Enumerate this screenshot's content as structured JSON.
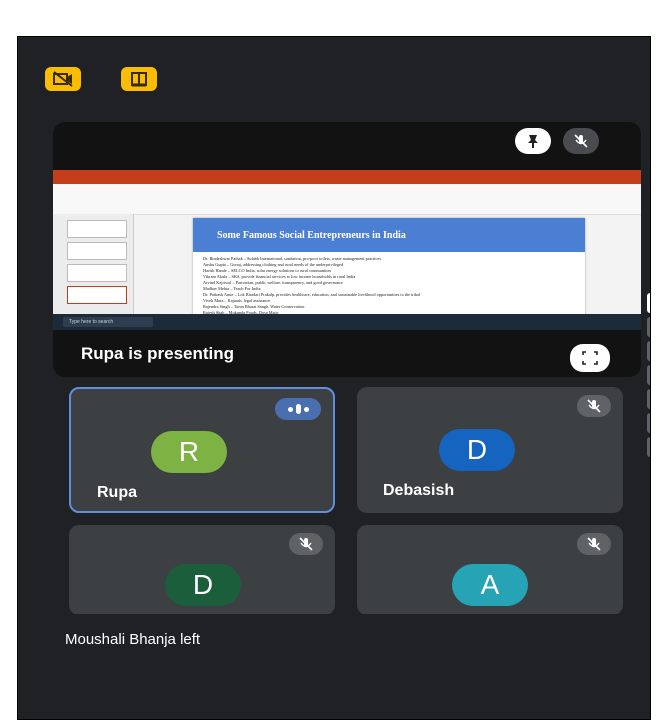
{
  "top_controls": {
    "camera_off_icon": "video-off-icon",
    "flip_icon": "layout-icon"
  },
  "stage": {
    "presenting_label": "Rupa is presenting",
    "pin_icon": "pin-icon",
    "mute_icon": "mic-off-icon",
    "fullscreen_icon": "fullscreen-icon",
    "slide": {
      "title": "Some Famous Social Entrepreneurs in India",
      "bullets": [
        "Dr. Bindeshwar Pathak – Sulabh International, sanitation, pro-poor toilets, waste management practices",
        "Anshu Gupta – Goonj, addressing clothing and rural needs of the underprivileged",
        "Harish Hande – SELCO India, solar energy solutions to rural communities",
        "Vikram Akula – SKS, provide financial services to low income households in rural India",
        "Arvind Kejriwal – Parivartan, public welfare, transparency, and good governance",
        "Madhav Mehta – Teach For India",
        "Dr. Prakash Amte – Lok Biradari Prakalp, provides healthcare, education, and sustainable livelihood opportunities to the tribal",
        "Vivek Mara – Kajaash, legal assistance",
        "Rajendra Singh – Tarun Bharat Sangh, Water Conservation",
        "Rajesh Shah – Mukunda Foods, Dosa Matic"
      ],
      "taskbar_search": "Type here to search"
    }
  },
  "participants": [
    {
      "name": "Rupa",
      "initial": "R",
      "color": "#7cb342",
      "speaking": true
    },
    {
      "name": "Debasish",
      "initial": "D",
      "color": "#1565c0",
      "speaking": false
    },
    {
      "name": "",
      "initial": "D",
      "color": "#1b5e3c",
      "speaking": false
    },
    {
      "name": "",
      "initial": "A",
      "color": "#26a3b5",
      "speaking": false
    }
  ],
  "notification": "Moushali Bhanja left",
  "colors": {
    "accent_yellow": "#fbbc04",
    "background": "#202124",
    "tile": "#3c4043",
    "active_border": "#5f8fdc"
  }
}
